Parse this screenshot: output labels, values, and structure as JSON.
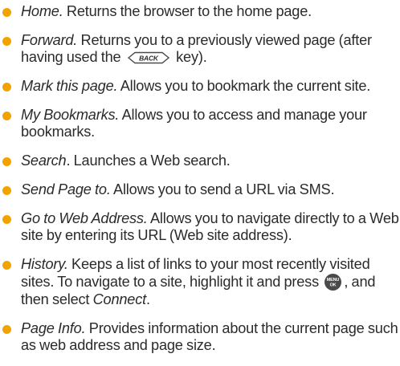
{
  "colors": {
    "bullet": "#f2a300",
    "text": "#2b2b2b",
    "key_fill": "#4a4a4a"
  },
  "items": [
    {
      "term": "Home.",
      "text": " Returns the browser to the home page."
    },
    {
      "term": "Forward.",
      "text_before": " Returns you to a previously viewed page (after having used the ",
      "key_label": "BACK",
      "key_icon": "back-key-icon",
      "text_after": " key)."
    },
    {
      "term": "Mark this page.",
      "text": " Allows you to bookmark the current site."
    },
    {
      "term": "My Bookmarks.",
      "text": " Allows you to access and manage your bookmarks."
    },
    {
      "term": "Search",
      "text": ". Launches a Web search."
    },
    {
      "term": "Send Page to.",
      "text": " Allows you to send a URL via SMS."
    },
    {
      "term": "Go to Web Address.",
      "text": " Allows you to navigate directly to a Web site by entering its URL (Web site address)."
    },
    {
      "term": "History.",
      "text_before": " Keeps a list of links to your most recently visited sites. To navigate to a site, highlight it and press ",
      "key_icon": "menu-ok-key-icon",
      "key_label_top": "MENU",
      "key_label_bottom": "OK",
      "text_mid": ", and then select ",
      "emph": "Connect",
      "text_after": "."
    },
    {
      "term": "Page Info.",
      "text": " Provides information about the current page such as web address and page size."
    }
  ]
}
